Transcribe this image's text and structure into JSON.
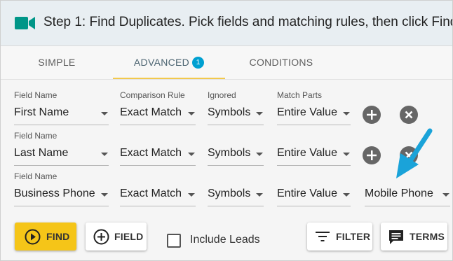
{
  "header": {
    "title": "Step 1: Find Duplicates. Pick fields and matching rules, then click Find",
    "icon": "video-camera-icon",
    "icon_color": "#009688"
  },
  "tabs": [
    {
      "label": "SIMPLE",
      "active": false
    },
    {
      "label": "ADVANCED",
      "active": true,
      "badge": "1"
    },
    {
      "label": "CONDITIONS",
      "active": false
    }
  ],
  "rules": [
    {
      "labels": {
        "field": "Field Name",
        "comparison": "Comparison Rule",
        "ignored": "Ignored",
        "match_parts": "Match Parts"
      },
      "field": "First Name",
      "comparison": "Exact Match",
      "ignored": "Symbols",
      "match_parts": "Entire Value"
    },
    {
      "labels": {
        "field": "Field Name"
      },
      "field": "Last Name",
      "comparison": "Exact Match",
      "ignored": "Symbols",
      "match_parts": "Entire Value"
    },
    {
      "labels": {
        "field": "Field Name"
      },
      "field": "Business Phone",
      "comparison": "Exact Match",
      "ignored": "Symbols",
      "match_parts": "Entire Value",
      "extra_field": "Mobile Phone"
    }
  ],
  "actions": {
    "find_label": "FIND",
    "field_label": "FIELD",
    "include_leads_label": "Include Leads",
    "include_leads_checked": false,
    "filter_label": "FILTER",
    "terms_label": "TERMS"
  },
  "colors": {
    "accent_yellow": "#f5c518",
    "badge_blue": "#00a0d1",
    "annotation_arrow": "#1aa3d9"
  }
}
